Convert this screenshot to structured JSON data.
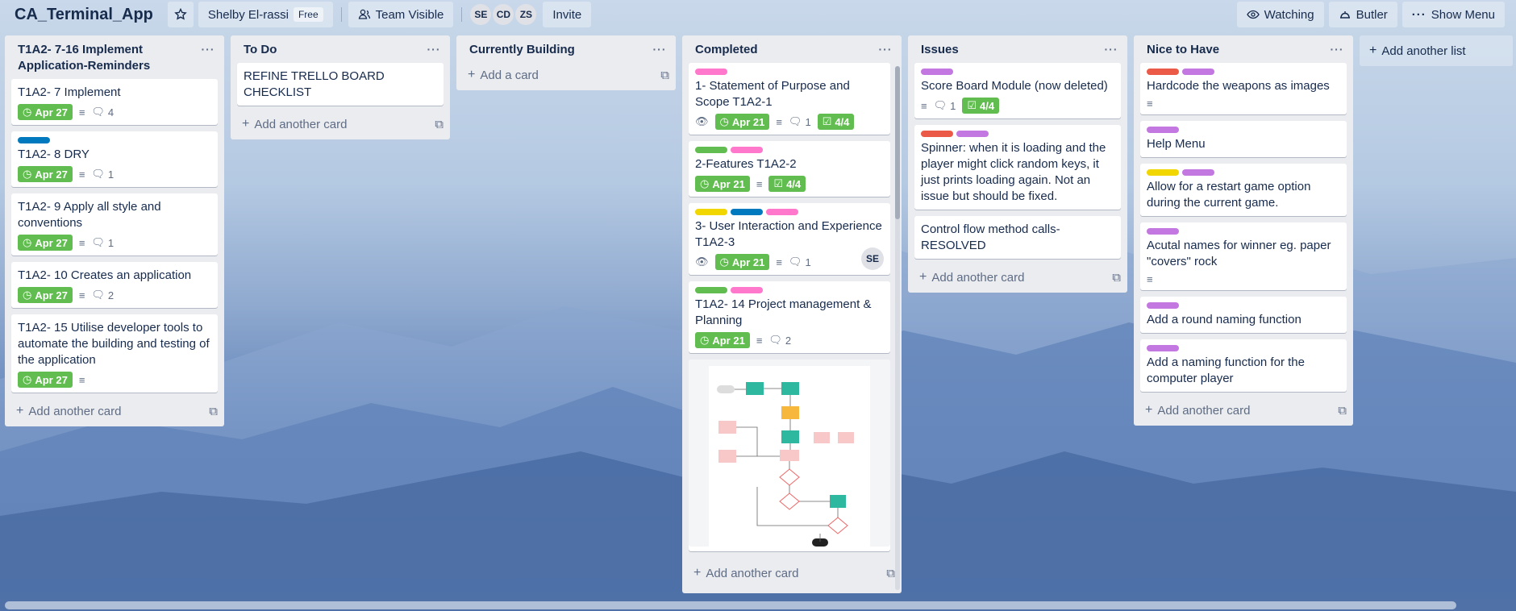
{
  "board": {
    "title": "CA_Terminal_App"
  },
  "header": {
    "workspace": "Shelby El-rassi",
    "plan_badge": "Free",
    "visibility": "Team Visible",
    "members": [
      "SE",
      "CD",
      "ZS"
    ],
    "invite": "Invite",
    "watching": "Watching",
    "butler": "Butler",
    "show_menu": "Show Menu"
  },
  "lists": [
    {
      "title": "T1A2- 7-16 Implement Application-Reminders",
      "add_label": "Add another card",
      "cards": [
        {
          "title": "T1A2- 7 Implement",
          "due": "Apr 27",
          "comments": "4"
        },
        {
          "title": "T1A2- 8 DRY",
          "due": "Apr 27",
          "comments": "1"
        },
        {
          "title": "T1A2- 9 Apply all style and conventions",
          "due": "Apr 27",
          "comments": "1"
        },
        {
          "title": "T1A2- 10 Creates an application",
          "due": "Apr 27",
          "comments": "2"
        },
        {
          "title": "T1A2- 15 Utilise developer tools to automate the building and testing of the application",
          "due": "Apr 27"
        }
      ]
    },
    {
      "title": "To Do",
      "add_label": "Add another card",
      "cards": [
        {
          "title": "REFINE TRELLO BOARD CHECKLIST"
        }
      ]
    },
    {
      "title": "Currently Building",
      "add_label": "Add a card",
      "cards": []
    },
    {
      "title": "Completed",
      "add_label": "Add another card",
      "cards": [
        {
          "title": "1- Statement of Purpose and Scope T1A2-1",
          "due": "Apr 21",
          "comments": "1",
          "checklist": "4/4"
        },
        {
          "title": "2-Features T1A2-2",
          "due": "Apr 21",
          "checklist": "4/4"
        },
        {
          "title": "3- User Interaction and Experience T1A2-3",
          "due": "Apr 21",
          "comments": "1",
          "member": "SE"
        },
        {
          "title": "T1A2- 14 Project management & Planning",
          "due": "Apr 21",
          "comments": "2"
        }
      ]
    },
    {
      "title": "Issues",
      "add_label": "Add another card",
      "cards": [
        {
          "title": "Score Board Module (now deleted)",
          "comments": "1",
          "checklist": "4/4"
        },
        {
          "title": "Spinner: when it is loading and the player might click random keys, it just prints loading again. Not an issue but should be fixed."
        },
        {
          "title": "Control flow method calls- RESOLVED"
        }
      ]
    },
    {
      "title": "Nice to Have",
      "add_label": "Add another card",
      "cards": [
        {
          "title": "Hardcode the weapons as images"
        },
        {
          "title": "Help Menu"
        },
        {
          "title": "Allow for a restart game option during the current game."
        },
        {
          "title": "Acutal names for winner eg. paper \"covers\" rock"
        },
        {
          "title": "Add a round naming function"
        },
        {
          "title": "Add a naming function for the computer player"
        }
      ]
    }
  ],
  "add_list": "Add another list",
  "colors": {
    "green": "#61bd4f",
    "yellow": "#f2d600",
    "red": "#eb5a46",
    "purple": "#c377e0",
    "blue": "#0079bf",
    "pink": "#ff78cb"
  }
}
